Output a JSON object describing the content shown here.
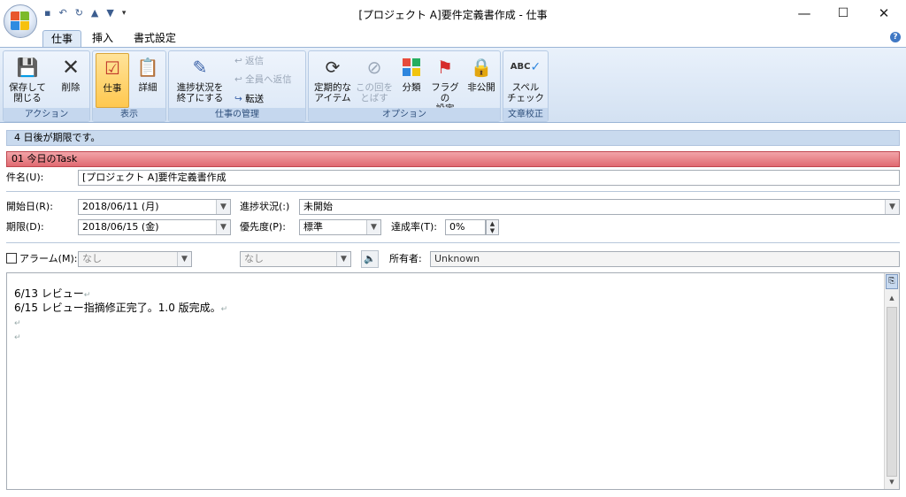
{
  "window": {
    "title": "[プロジェクト A]要件定義書作成 - 仕事",
    "minimize": "—",
    "maximize": "☐",
    "close": "✕"
  },
  "tabs": [
    "仕事",
    "挿入",
    "書式設定"
  ],
  "ribbon": {
    "groups": {
      "action": "アクション",
      "view": "表示",
      "task_manage": "仕事の管理",
      "options": "オプション",
      "proofing": "文章校正"
    },
    "buttons": {
      "save_close": [
        "保存して",
        "閉じる"
      ],
      "delete": "削除",
      "task": "仕事",
      "detail": "詳細",
      "mark_complete": [
        "進捗状況を",
        "終了にする"
      ],
      "reply": "返信",
      "reply_all": "全員へ返信",
      "forward": "転送",
      "recurrence": [
        "定期的な",
        "アイテム"
      ],
      "skip_occurrence": [
        "この回を",
        "とばす"
      ],
      "categorize": "分類",
      "follow_up": [
        "フラグの",
        "設定"
      ],
      "private": "非公開",
      "spelling": [
        "スペル",
        "チェック"
      ]
    }
  },
  "infobar": {
    "due_notice": "4 日後が期限です。",
    "category": "01 今日のTask"
  },
  "form": {
    "subject_label": "件名(U):",
    "subject_value": "[プロジェクト A]要件定義書作成",
    "start_label": "開始日(R):",
    "start_value": "2018/06/11 (月)",
    "due_label": "期限(D):",
    "due_value": "2018/06/15 (金)",
    "status_label": "進捗状況(:)",
    "status_value": "未開始",
    "priority_label": "優先度(P):",
    "priority_value": "標準",
    "percent_label": "達成率(T):",
    "percent_value": "0%",
    "alarm_label": "アラーム(M):",
    "alarm_date": "なし",
    "alarm_time": "なし",
    "owner_label": "所有者:",
    "owner_value": "Unknown"
  },
  "body": {
    "lines": [
      "6/13 レビュー",
      "6/15 レビュー指摘修正完了。1.0 版完成。",
      "",
      ""
    ],
    "para_mark": "↵"
  },
  "icons": {
    "save": "💾",
    "delete": "✕",
    "task": "☑",
    "detail": "📋",
    "complete": "✎",
    "recurrence": "⟳",
    "skip": "⊘",
    "categorize": "▦",
    "flag": "⚑",
    "lock": "🔒",
    "spelling": "ABC✓"
  },
  "colors": {
    "category_bar": "#e06a71",
    "infobar": "#c9daee",
    "ribbon": "#d3e1f2",
    "active_button": "#ffc84f"
  }
}
